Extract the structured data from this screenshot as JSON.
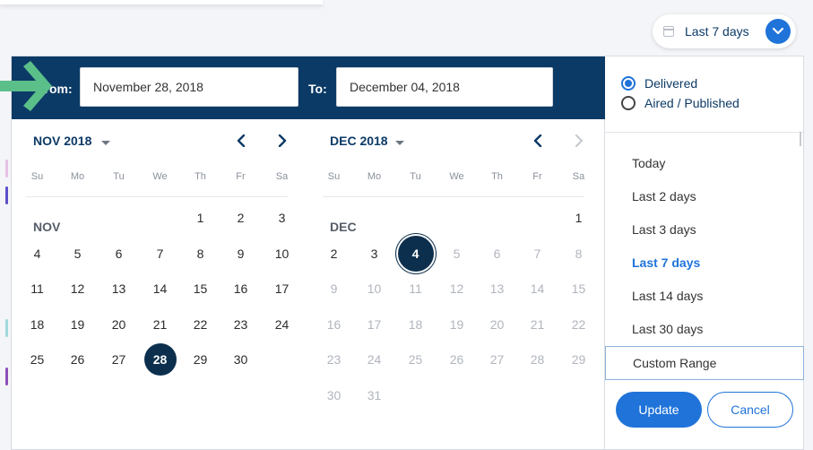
{
  "toggle": {
    "label": "Last 7 days",
    "icon": "calendar-icon"
  },
  "header": {
    "from_label": "From:",
    "from_value": "November 28, 2018",
    "to_label": "To:",
    "to_value": "December 04, 2018"
  },
  "colors": {
    "navy": "#0c3a66",
    "accent": "#1f73d9",
    "arrow": "#5bbf8a",
    "selected": "#0c2f4d"
  },
  "weekdays": [
    "Su",
    "Mo",
    "Tu",
    "We",
    "Th",
    "Fr",
    "Sa"
  ],
  "calendars": [
    {
      "title": "NOV 2018",
      "month_label": "NOV",
      "lead_blanks": 4,
      "days": 30,
      "selected": [
        28
      ],
      "disabled_from": null
    },
    {
      "title": "DEC 2018",
      "month_label": "DEC",
      "lead_blanks": 6,
      "days": 31,
      "selected": [
        4
      ],
      "disabled_from": 5
    }
  ],
  "sidebar": {
    "status_options": [
      {
        "label": "Delivered",
        "checked": true
      },
      {
        "label": "Aired / Published",
        "checked": false
      }
    ],
    "ranges": [
      {
        "label": "Today",
        "active": false
      },
      {
        "label": "Last 2 days",
        "active": false
      },
      {
        "label": "Last 3 days",
        "active": false
      },
      {
        "label": "Last 7 days",
        "active": true
      },
      {
        "label": "Last 14 days",
        "active": false
      },
      {
        "label": "Last 30 days",
        "active": false
      }
    ],
    "custom_label": "Custom Range",
    "update_label": "Update",
    "cancel_label": "Cancel"
  }
}
